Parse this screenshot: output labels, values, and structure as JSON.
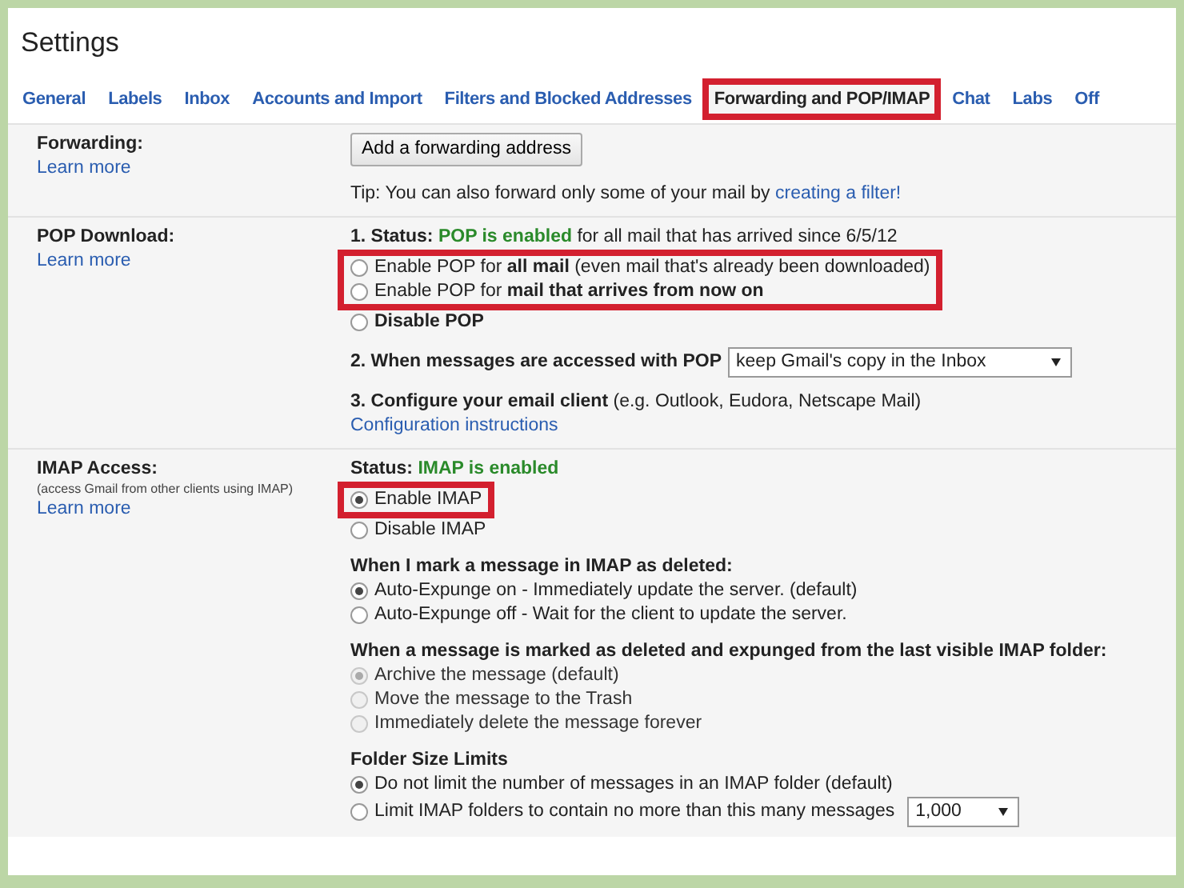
{
  "title": "Settings",
  "tabs": [
    {
      "label": "General",
      "selected": false,
      "highlighted": false
    },
    {
      "label": "Labels",
      "selected": false,
      "highlighted": false
    },
    {
      "label": "Inbox",
      "selected": false,
      "highlighted": false
    },
    {
      "label": "Accounts and Import",
      "selected": false,
      "highlighted": false
    },
    {
      "label": "Filters and Blocked Addresses",
      "selected": false,
      "highlighted": false
    },
    {
      "label": "Forwarding and POP/IMAP",
      "selected": true,
      "highlighted": true
    },
    {
      "label": "Chat",
      "selected": false,
      "highlighted": false
    },
    {
      "label": "Labs",
      "selected": false,
      "highlighted": false
    },
    {
      "label": "Off",
      "selected": false,
      "highlighted": false
    }
  ],
  "sections": [
    {
      "label": "Forwarding:",
      "learn_more": "Learn more",
      "items": [
        {
          "kind": "button",
          "text": "Add a forwarding address"
        },
        {
          "kind": "tip",
          "text": "Tip: You can also forward only some of your mail by",
          "link": "creating a filter!"
        }
      ]
    },
    {
      "label": "POP Download:",
      "learn_more": "Learn more",
      "items": [
        {
          "kind": "status",
          "prefix": "1. Status:",
          "state": "POP is enabled",
          "suffix": "for all mail that has arrived since 6/5/12"
        },
        {
          "kind": "radios",
          "highlighted": true,
          "options": [
            {
              "label": "Enable POP for **all mail** (even mail that's already been downloaded)",
              "selected": false,
              "disabled": false
            },
            {
              "label": "Enable POP for **mail that arrives from now on**",
              "selected": false,
              "disabled": false
            }
          ]
        },
        {
          "kind": "radios",
          "highlighted": false,
          "options": [
            {
              "label": "**Disable POP**",
              "selected": false,
              "disabled": false
            }
          ]
        },
        {
          "kind": "select-row",
          "text": "**2. When messages are accessed with POP**",
          "value": "keep Gmail's copy in the Inbox"
        },
        {
          "kind": "text",
          "text": "**3. Configure your email client** (e.g. Outlook, Eudora, Netscape Mail)"
        },
        {
          "kind": "link",
          "text": "Configuration instructions"
        }
      ]
    },
    {
      "label": "IMAP Access:",
      "note": "(access Gmail from other clients using IMAP)",
      "learn_more": "Learn more",
      "items": [
        {
          "kind": "status",
          "prefix": "Status:",
          "state": "IMAP is enabled"
        },
        {
          "kind": "radios",
          "highlighted": true,
          "options": [
            {
              "label": "Enable IMAP",
              "selected": true,
              "disabled": false
            }
          ]
        },
        {
          "kind": "radios",
          "highlighted": false,
          "options": [
            {
              "label": "Disable IMAP",
              "selected": false,
              "disabled": false
            }
          ]
        },
        {
          "kind": "heading",
          "text": "When I mark a message in IMAP as deleted:"
        },
        {
          "kind": "radios",
          "highlighted": false,
          "options": [
            {
              "label": "Auto-Expunge on - Immediately update the server. (default)",
              "selected": true,
              "disabled": false
            },
            {
              "label": "Auto-Expunge off - Wait for the client to update the server.",
              "selected": false,
              "disabled": false
            }
          ]
        },
        {
          "kind": "heading",
          "text": "When a message is marked as deleted and expunged from the last visible IMAP folder:"
        },
        {
          "kind": "radios",
          "highlighted": false,
          "options": [
            {
              "label": "Archive the message (default)",
              "selected": true,
              "disabled": true
            },
            {
              "label": "Move the message to the Trash",
              "selected": false,
              "disabled": true
            },
            {
              "label": "Immediately delete the message forever",
              "selected": false,
              "disabled": true
            }
          ]
        },
        {
          "kind": "heading",
          "text": "Folder Size Limits"
        },
        {
          "kind": "radios",
          "highlighted": false,
          "options": [
            {
              "label": "Do not limit the number of messages in an IMAP folder (default)",
              "selected": true,
              "disabled": false
            },
            {
              "label": "Limit IMAP folders to contain no more than this many messages",
              "selected": false,
              "disabled": false,
              "select_value": "1,000"
            }
          ]
        }
      ]
    }
  ]
}
